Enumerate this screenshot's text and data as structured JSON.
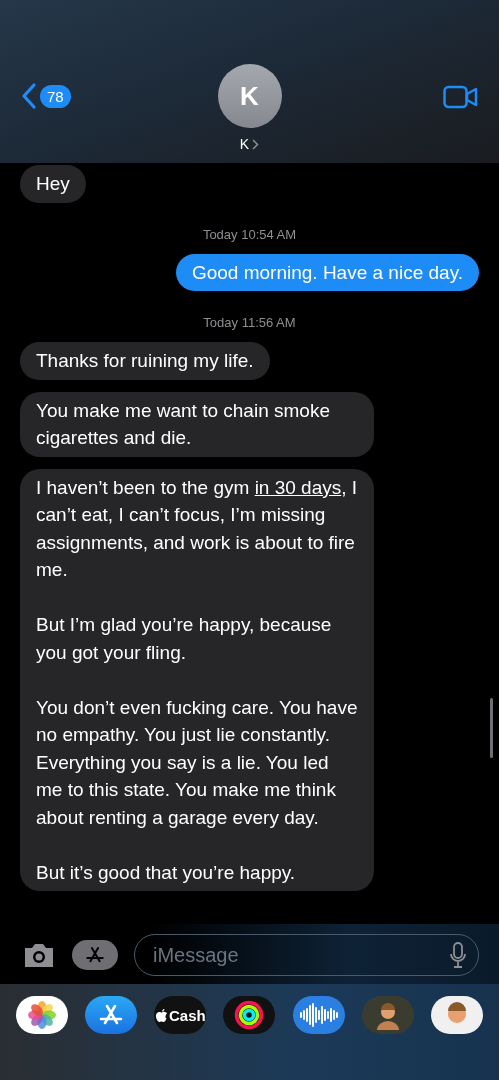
{
  "header": {
    "back_badge": "78",
    "avatar_initial": "K",
    "contact_name": "K"
  },
  "messages": [
    {
      "kind": "incoming",
      "paragraphs": [
        [
          {
            "text": "Hey"
          }
        ]
      ]
    },
    {
      "kind": "timestamp",
      "text": "Today 10:54 AM"
    },
    {
      "kind": "outgoing",
      "paragraphs": [
        [
          {
            "text": "Good morning. Have a nice day."
          }
        ]
      ]
    },
    {
      "kind": "timestamp",
      "text": "Today 11:56 AM"
    },
    {
      "kind": "incoming",
      "paragraphs": [
        [
          {
            "text": "Thanks for ruining my life."
          }
        ]
      ]
    },
    {
      "kind": "incoming",
      "paragraphs": [
        [
          {
            "text": "You make me want to chain smoke cigarettes and die."
          }
        ]
      ]
    },
    {
      "kind": "incoming",
      "paragraphs": [
        [
          {
            "text": "I haven’t been to the gym "
          },
          {
            "text": "in 30 days",
            "link": true
          },
          {
            "text": ", I can’t eat, I can’t focus, I’m missing assignments, and work is about to fire me."
          }
        ],
        [
          {
            "text": "But I’m glad you’re happy, because you got your fling."
          }
        ],
        [
          {
            "text": "You don’t even fucking care. You have no empathy. You just lie constantly. Everything you say is a lie. You led me to this state. You make me think about renting a garage every day."
          }
        ],
        [
          {
            "text": "But it’s good that you’re happy."
          }
        ]
      ]
    }
  ],
  "composer": {
    "placeholder": "iMessage"
  },
  "app_strip": [
    {
      "kind": "photos"
    },
    {
      "kind": "appstore"
    },
    {
      "kind": "cash",
      "label": "Cash"
    },
    {
      "kind": "activity"
    },
    {
      "kind": "audio"
    },
    {
      "kind": "memoji"
    },
    {
      "kind": "stickers"
    }
  ]
}
